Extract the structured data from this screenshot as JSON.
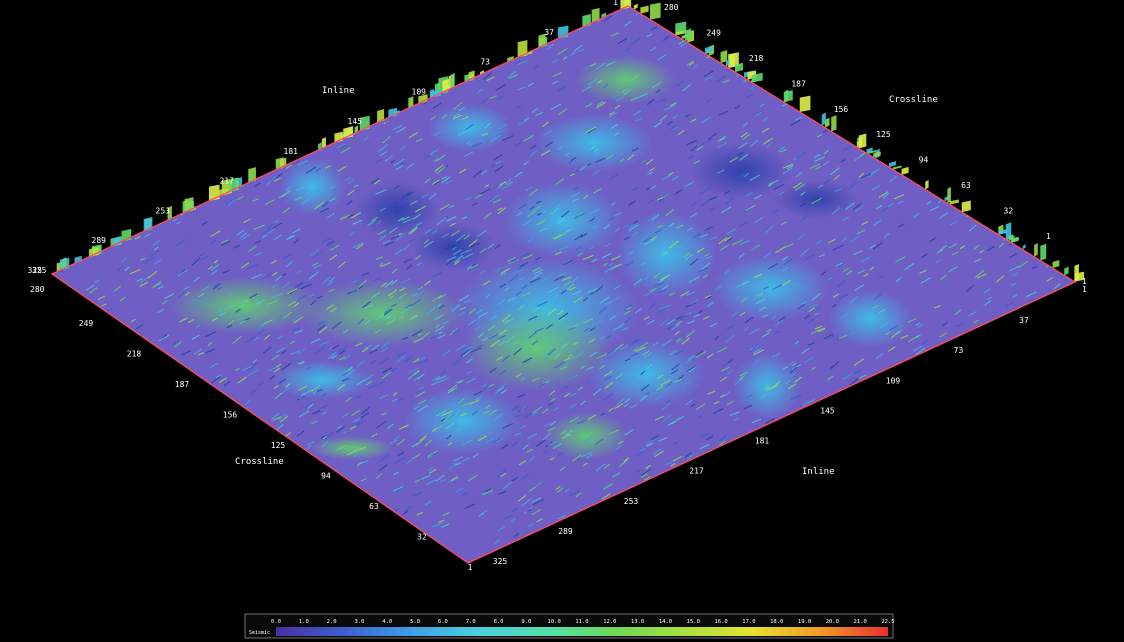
{
  "figure": {
    "background_color": "#000000",
    "surface_base_color": "#6f5ec4",
    "frame_color": "#ff4a5f"
  },
  "axes": {
    "inline_title": "Inline",
    "crossline_title": "Crossline",
    "top_left_edge_ticks": [
      "1",
      "37",
      "73",
      "109",
      "145",
      "181",
      "217",
      "253",
      "289",
      "325"
    ],
    "top_right_edge_ticks": [
      "280",
      "249",
      "218",
      "187",
      "156",
      "125",
      "94",
      "63",
      "32",
      "1"
    ],
    "right_edge_ticks": [
      "1",
      "1"
    ],
    "bottom_right_edge_ticks": [
      "37",
      "73",
      "109",
      "145",
      "181",
      "217",
      "253",
      "289",
      "325"
    ],
    "left_edge_ticks": [
      "325",
      "280"
    ],
    "bottom_left_edge_ticks": [
      "249",
      "218",
      "187",
      "156",
      "125",
      "94",
      "63",
      "32",
      "1"
    ]
  },
  "colorbar": {
    "label": "Seismic",
    "tick_labels": [
      "0.0",
      "1.0",
      "2.0",
      "3.0",
      "4.0",
      "5.0",
      "6.0",
      "7.0",
      "8.0",
      "9.0",
      "10.0",
      "11.0",
      "12.0",
      "13.0",
      "14.0",
      "15.0",
      "16.0",
      "17.0",
      "18.0",
      "19.0",
      "20.0",
      "21.0",
      "22.5"
    ],
    "gradient_colors": [
      "#4a2fa3",
      "#3f5fd0",
      "#3fa0e8",
      "#4ad0e0",
      "#52e0a8",
      "#6cd858",
      "#a8e040",
      "#e8e030",
      "#f09a28",
      "#e83030"
    ]
  }
}
